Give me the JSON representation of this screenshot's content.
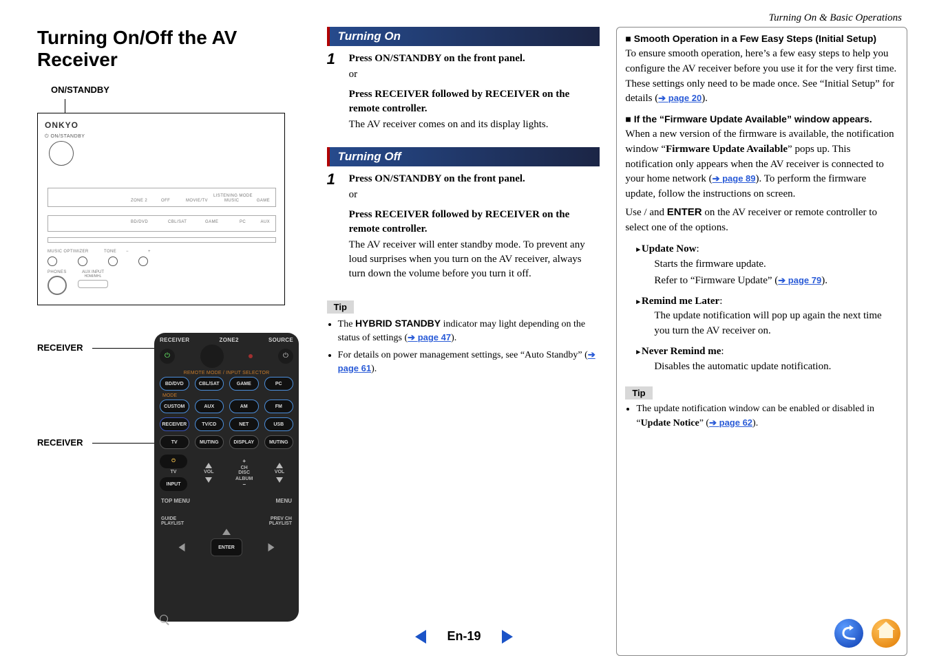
{
  "breadcrumb": "Turning On & Basic Operations",
  "title": "Turning On/Off the AV Receiver",
  "labels": {
    "on_standby": "ON/STANDBY",
    "receiver": "RECEIVER",
    "brand": "ONKYO"
  },
  "front_panel": {
    "standby_small": "ON/STANDBY",
    "zone2": "ZONE 2",
    "off": "OFF",
    "movietv": "MOVIE/TV",
    "listening_mode": "LISTENING MODE",
    "music": "MUSIC",
    "game": "GAME",
    "row2": {
      "bddvd": "BD/DVD",
      "cblsat": "CBL/SAT",
      "game": "GAME",
      "pc": "PC",
      "aux": "AUX"
    },
    "music_opt": "MUSIC OPTIMIZER",
    "tone": "TONE",
    "phones": "PHONES",
    "aux_input": "AUX INPUT"
  },
  "remote": {
    "top_labels": {
      "receiver": "RECEIVER",
      "zone2": "ZONE2",
      "source": "SOURCE"
    },
    "section_mode_selector": "REMOTE MODE / INPUT SELECTOR",
    "mode": "MODE",
    "grid": [
      "BD/DVD",
      "CBL/SAT",
      "GAME",
      "PC",
      "CUSTOM",
      "AUX",
      "AM",
      "FM",
      "RECEIVER",
      "TV/CD",
      "NET",
      "USB",
      "TV",
      "MUTING",
      "DISPLAY",
      "MUTING"
    ],
    "nav_rows": {
      "tv": "TV",
      "vol": "VOL",
      "ch_disc": "CH\nDISC",
      "album": "ALBUM",
      "input": "INPUT"
    },
    "menu_row": {
      "top_menu": "TOP MENU",
      "menu": "MENU"
    },
    "gp_row": {
      "guide": "GUIDE",
      "prev_ch": "PREV CH",
      "playlist_l": "PLAYLIST",
      "enter": "ENTER",
      "playlist_r": "PLAYLIST"
    }
  },
  "turning_on": {
    "heading": "Turning On",
    "step1_a": "Press   ON/STANDBY on the front panel.",
    "or": "or",
    "step1_b1": "Press RECEIVER followed by   RECEIVER on the remote controller.",
    "step1_result": "The AV receiver comes on and its display lights."
  },
  "turning_off": {
    "heading": "Turning Off",
    "step1_a": "Press   ON/STANDBY on the front panel.",
    "or": "or",
    "step1_b1": "Press RECEIVER followed by   RECEIVER on the remote controller.",
    "step1_result": "The AV receiver will enter standby mode. To prevent any loud surprises when you turn on the AV receiver, always turn down the volume before you turn it off."
  },
  "tips_mid": {
    "label": "Tip",
    "t1_a": "The ",
    "t1_b": "HYBRID STANDBY",
    "t1_c": " indicator may light depending on the status of settings (",
    "t1_link": "page 47",
    "t1_d": ").",
    "t2_a": "For details on power management settings, see “Auto Standby” (",
    "t2_link": "page 61",
    "t2_b": ")."
  },
  "right": {
    "h1": "Smooth Operation in a Few Easy Steps (Initial Setup)",
    "p1_a": "To ensure smooth operation, here’s a few easy steps to help you configure the AV receiver before you use it for the very first time. These settings only need to be made once. See “Initial Setup” for details (",
    "p1_link": "page 20",
    "p1_b": ").",
    "h2": "If the “Firmware Update Available” window appears.",
    "p2_a": "When a new version of the firmware is available, the notification window “",
    "p2_b": "Firmware Update Available",
    "p2_c": "” pops up. This notification only appears when the AV receiver is connected to your home network (",
    "p2_link": "page 89",
    "p2_d": "). To perform the firmware update, follow the instructions on screen.",
    "p3_a": "Use   /   and ",
    "p3_enter": "ENTER",
    "p3_b": " on the AV receiver or remote controller to select one of the options.",
    "opt1_t": "Update Now",
    "opt1_d1": "Starts the firmware update.",
    "opt1_d2a": "Refer to “Firmware Update” (",
    "opt1_link": "page 79",
    "opt1_d2b": ").",
    "opt2_t": "Remind me Later",
    "opt2_d": "The update notification will pop up again the next time you turn the AV receiver on.",
    "opt3_t": "Never Remind me",
    "opt3_d": "Disables the automatic update notification.",
    "tip_label": "Tip",
    "tip_a": "The update notification window can be enabled or disabled in “",
    "tip_b": "Update Notice",
    "tip_c": "” (",
    "tip_link": "page 62",
    "tip_d": ")."
  },
  "footer": {
    "page": "En-19"
  }
}
